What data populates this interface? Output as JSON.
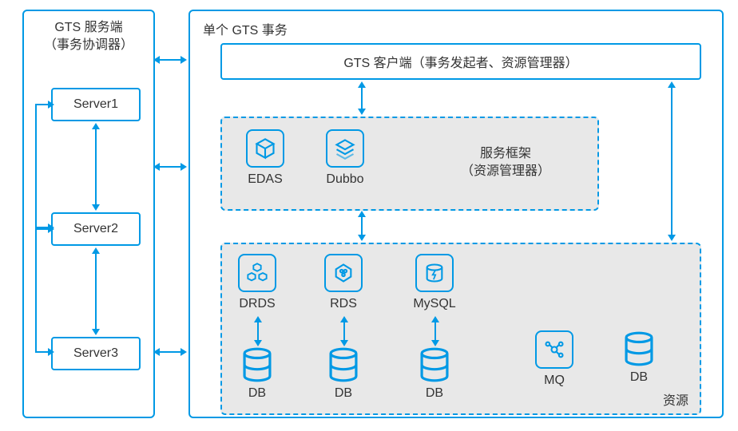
{
  "left": {
    "title_line1": "GTS 服务端",
    "title_line2": "（事务协调器）",
    "servers": [
      "Server1",
      "Server2",
      "Server3"
    ]
  },
  "right": {
    "title": "单个 GTS 事务",
    "client": "GTS 客户端（事务发起者、资源管理器）",
    "middle": {
      "edas": "EDAS",
      "dubbo": "Dubbo",
      "framework_line1": "服务框架",
      "framework_line2": "（资源管理器）"
    },
    "bottom": {
      "drds": "DRDS",
      "rds": "RDS",
      "mysql": "MySQL",
      "db": "DB",
      "mq": "MQ",
      "label": "资源"
    }
  }
}
